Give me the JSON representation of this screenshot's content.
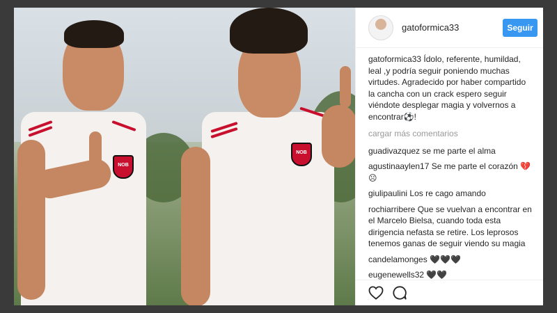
{
  "post": {
    "username": "gatoformica33",
    "follow_label": "Seguir",
    "caption_user": "gatoformica33",
    "caption_text": "Ídolo, referente, humildad, leal ,y podría seguir poniendo muchas virtudes. Agradecido por haber compartido la cancha con un crack espero seguir viéndote desplegar magia y volvernos a encontrar⚽!",
    "load_more": "cargar más comentarios",
    "comments": [
      {
        "user": "guadivazquez",
        "text": "se me parte el alma"
      },
      {
        "user": "agustinaaylen17",
        "text": "Se me parte el corazón 💔 ☹"
      },
      {
        "user": "giulipaulini",
        "text": "Los re cago amando"
      },
      {
        "user": "rochiarribere",
        "text": "Que se vuelvan a encontrar en el Marcelo Bielsa, cuando toda esta dirigencia nefasta se retire. Los leprosos tenemos ganas de seguir viendo su magia"
      },
      {
        "user": "candelamonges",
        "text": "🖤🖤🖤"
      },
      {
        "user": "eugenewells32",
        "text": "🖤🖤"
      }
    ],
    "badge_text": "NOB",
    "icons": {
      "like": "heart-icon",
      "comment": "speech-bubble-icon"
    },
    "colors": {
      "accent": "#3897f0",
      "club_red": "#c8102e"
    }
  }
}
